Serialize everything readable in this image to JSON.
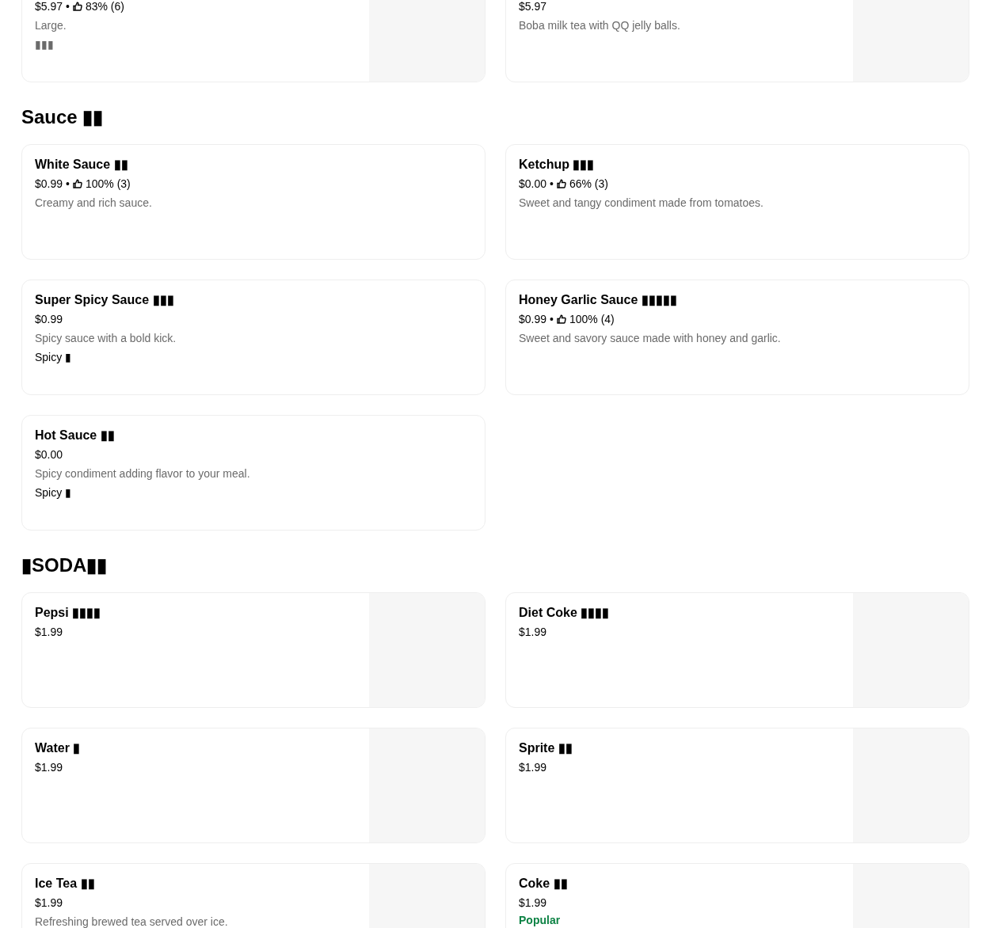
{
  "sections": [
    {
      "items": [
        {
          "kind": "photo",
          "price": "$5.97",
          "separator": "•",
          "rating": "83% (6)",
          "description": "Large.\n▮▮▮"
        },
        {
          "kind": "photo",
          "price": "$5.97",
          "description": "Boba milk tea with QQ jelly balls."
        }
      ]
    },
    {
      "title": "Sauce ▮▮",
      "items": [
        {
          "kind": "plain",
          "name": "White Sauce ▮▮",
          "price": "$0.99",
          "separator": "•",
          "rating": "100% (3)",
          "description": "Creamy and rich sauce."
        },
        {
          "kind": "plain",
          "name": "Ketchup ▮▮▮",
          "price": "$0.00",
          "separator": "•",
          "rating": "66% (3)",
          "description": "Sweet and tangy condiment made from tomatoes."
        },
        {
          "kind": "plain",
          "name": "Super Spicy Sauce ▮▮▮",
          "price": "$0.99",
          "description": "Spicy sauce with a bold kick.",
          "tag": "Spicy ▮"
        },
        {
          "kind": "plain",
          "name": "Honey Garlic Sauce ▮▮▮▮▮",
          "price": "$0.99",
          "separator": "•",
          "rating": "100% (4)",
          "description": "Sweet and savory sauce made with honey and garlic."
        },
        {
          "kind": "plain",
          "name": "Hot Sauce ▮▮",
          "price": "$0.00",
          "description": "Spicy condiment adding flavor to your meal.",
          "tag": "Spicy ▮"
        }
      ]
    },
    {
      "title": "▮SODA▮▮",
      "items": [
        {
          "kind": "photo",
          "name": "Pepsi ▮▮▮▮",
          "price": "$1.99"
        },
        {
          "kind": "photo",
          "name": "Diet Coke ▮▮▮▮",
          "price": "$1.99"
        },
        {
          "kind": "photo",
          "name": "Water ▮",
          "price": "$1.99"
        },
        {
          "kind": "photo",
          "name": "Sprite ▮▮",
          "price": "$1.99"
        },
        {
          "kind": "photo",
          "name": "Ice Tea ▮▮",
          "price": "$1.99",
          "description": "Refreshing brewed tea served over ice."
        },
        {
          "kind": "photo",
          "name": "Coke ▮▮",
          "price": "$1.99",
          "badge": "Popular"
        }
      ]
    }
  ]
}
